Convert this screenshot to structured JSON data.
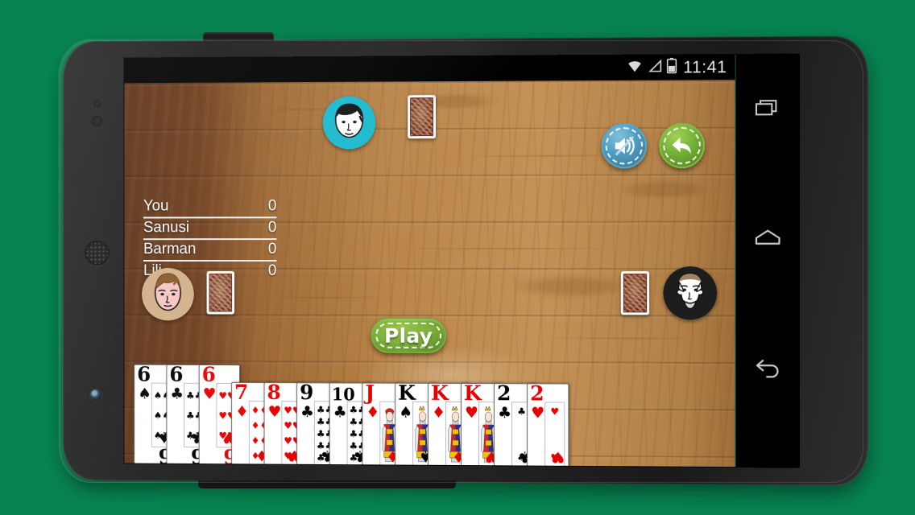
{
  "app": {
    "background_color": "#068450",
    "table_color": "#b9854a"
  },
  "statusbar": {
    "time": "11:41",
    "icons": [
      "wifi-icon",
      "signal-icon",
      "battery-icon"
    ]
  },
  "scoreboard": {
    "rows": [
      {
        "name": "You",
        "score": "0"
      },
      {
        "name": "Sanusi",
        "score": "0"
      },
      {
        "name": "Barman",
        "score": "0"
      },
      {
        "name": "Lili",
        "score": "0"
      }
    ]
  },
  "players": {
    "top": {
      "seat": "top",
      "avatar_bg": "#1ab9cf",
      "hair": "#141414",
      "skin": "#ffffff",
      "card_count": 1
    },
    "left": {
      "seat": "left",
      "avatar_bg": "#d3b189",
      "hair": "#8a5a2b",
      "skin": "#f7c6c1",
      "card_count": 1
    },
    "right": {
      "seat": "right",
      "avatar_bg": "#1d1d1d",
      "hair": "#ffffff",
      "skin": "#ffffff",
      "card_count": 1
    }
  },
  "controls": {
    "mute_button": {
      "label": "mute",
      "icon": "speaker-muted-icon",
      "color": "#4e9cc1"
    },
    "back_button": {
      "label": "back",
      "icon": "back-arrow-icon",
      "color": "#73b036"
    },
    "play_button": {
      "label": "Play",
      "color": "#7bb03a"
    }
  },
  "hand": {
    "cards": [
      {
        "rank": "6",
        "suit": "spades",
        "symbol": "♠",
        "color": "black",
        "raised": true
      },
      {
        "rank": "6",
        "suit": "clubs",
        "symbol": "♣",
        "color": "black",
        "raised": true
      },
      {
        "rank": "6",
        "suit": "hearts",
        "symbol": "♥",
        "color": "red",
        "raised": true
      },
      {
        "rank": "7",
        "suit": "diamonds",
        "symbol": "♦",
        "color": "red",
        "raised": false
      },
      {
        "rank": "8",
        "suit": "hearts",
        "symbol": "♥",
        "color": "red",
        "raised": false
      },
      {
        "rank": "9",
        "suit": "clubs",
        "symbol": "♣",
        "color": "black",
        "raised": false
      },
      {
        "rank": "10",
        "suit": "clubs",
        "symbol": "♣",
        "color": "black",
        "raised": false
      },
      {
        "rank": "J",
        "suit": "diamonds",
        "symbol": "♦",
        "color": "red",
        "raised": false
      },
      {
        "rank": "K",
        "suit": "spades",
        "symbol": "♠",
        "color": "black",
        "raised": false
      },
      {
        "rank": "K",
        "suit": "diamonds",
        "symbol": "♦",
        "color": "red",
        "raised": false
      },
      {
        "rank": "K",
        "suit": "hearts",
        "symbol": "♥",
        "color": "red",
        "raised": false
      },
      {
        "rank": "2",
        "suit": "clubs",
        "symbol": "♣",
        "color": "black",
        "raised": false
      },
      {
        "rank": "2",
        "suit": "hearts",
        "symbol": "♥",
        "color": "red",
        "raised": false
      }
    ]
  },
  "navbar": {
    "buttons": [
      {
        "name": "recents",
        "icon": "recents-icon"
      },
      {
        "name": "home",
        "icon": "home-icon"
      },
      {
        "name": "back",
        "icon": "back-icon"
      }
    ]
  }
}
